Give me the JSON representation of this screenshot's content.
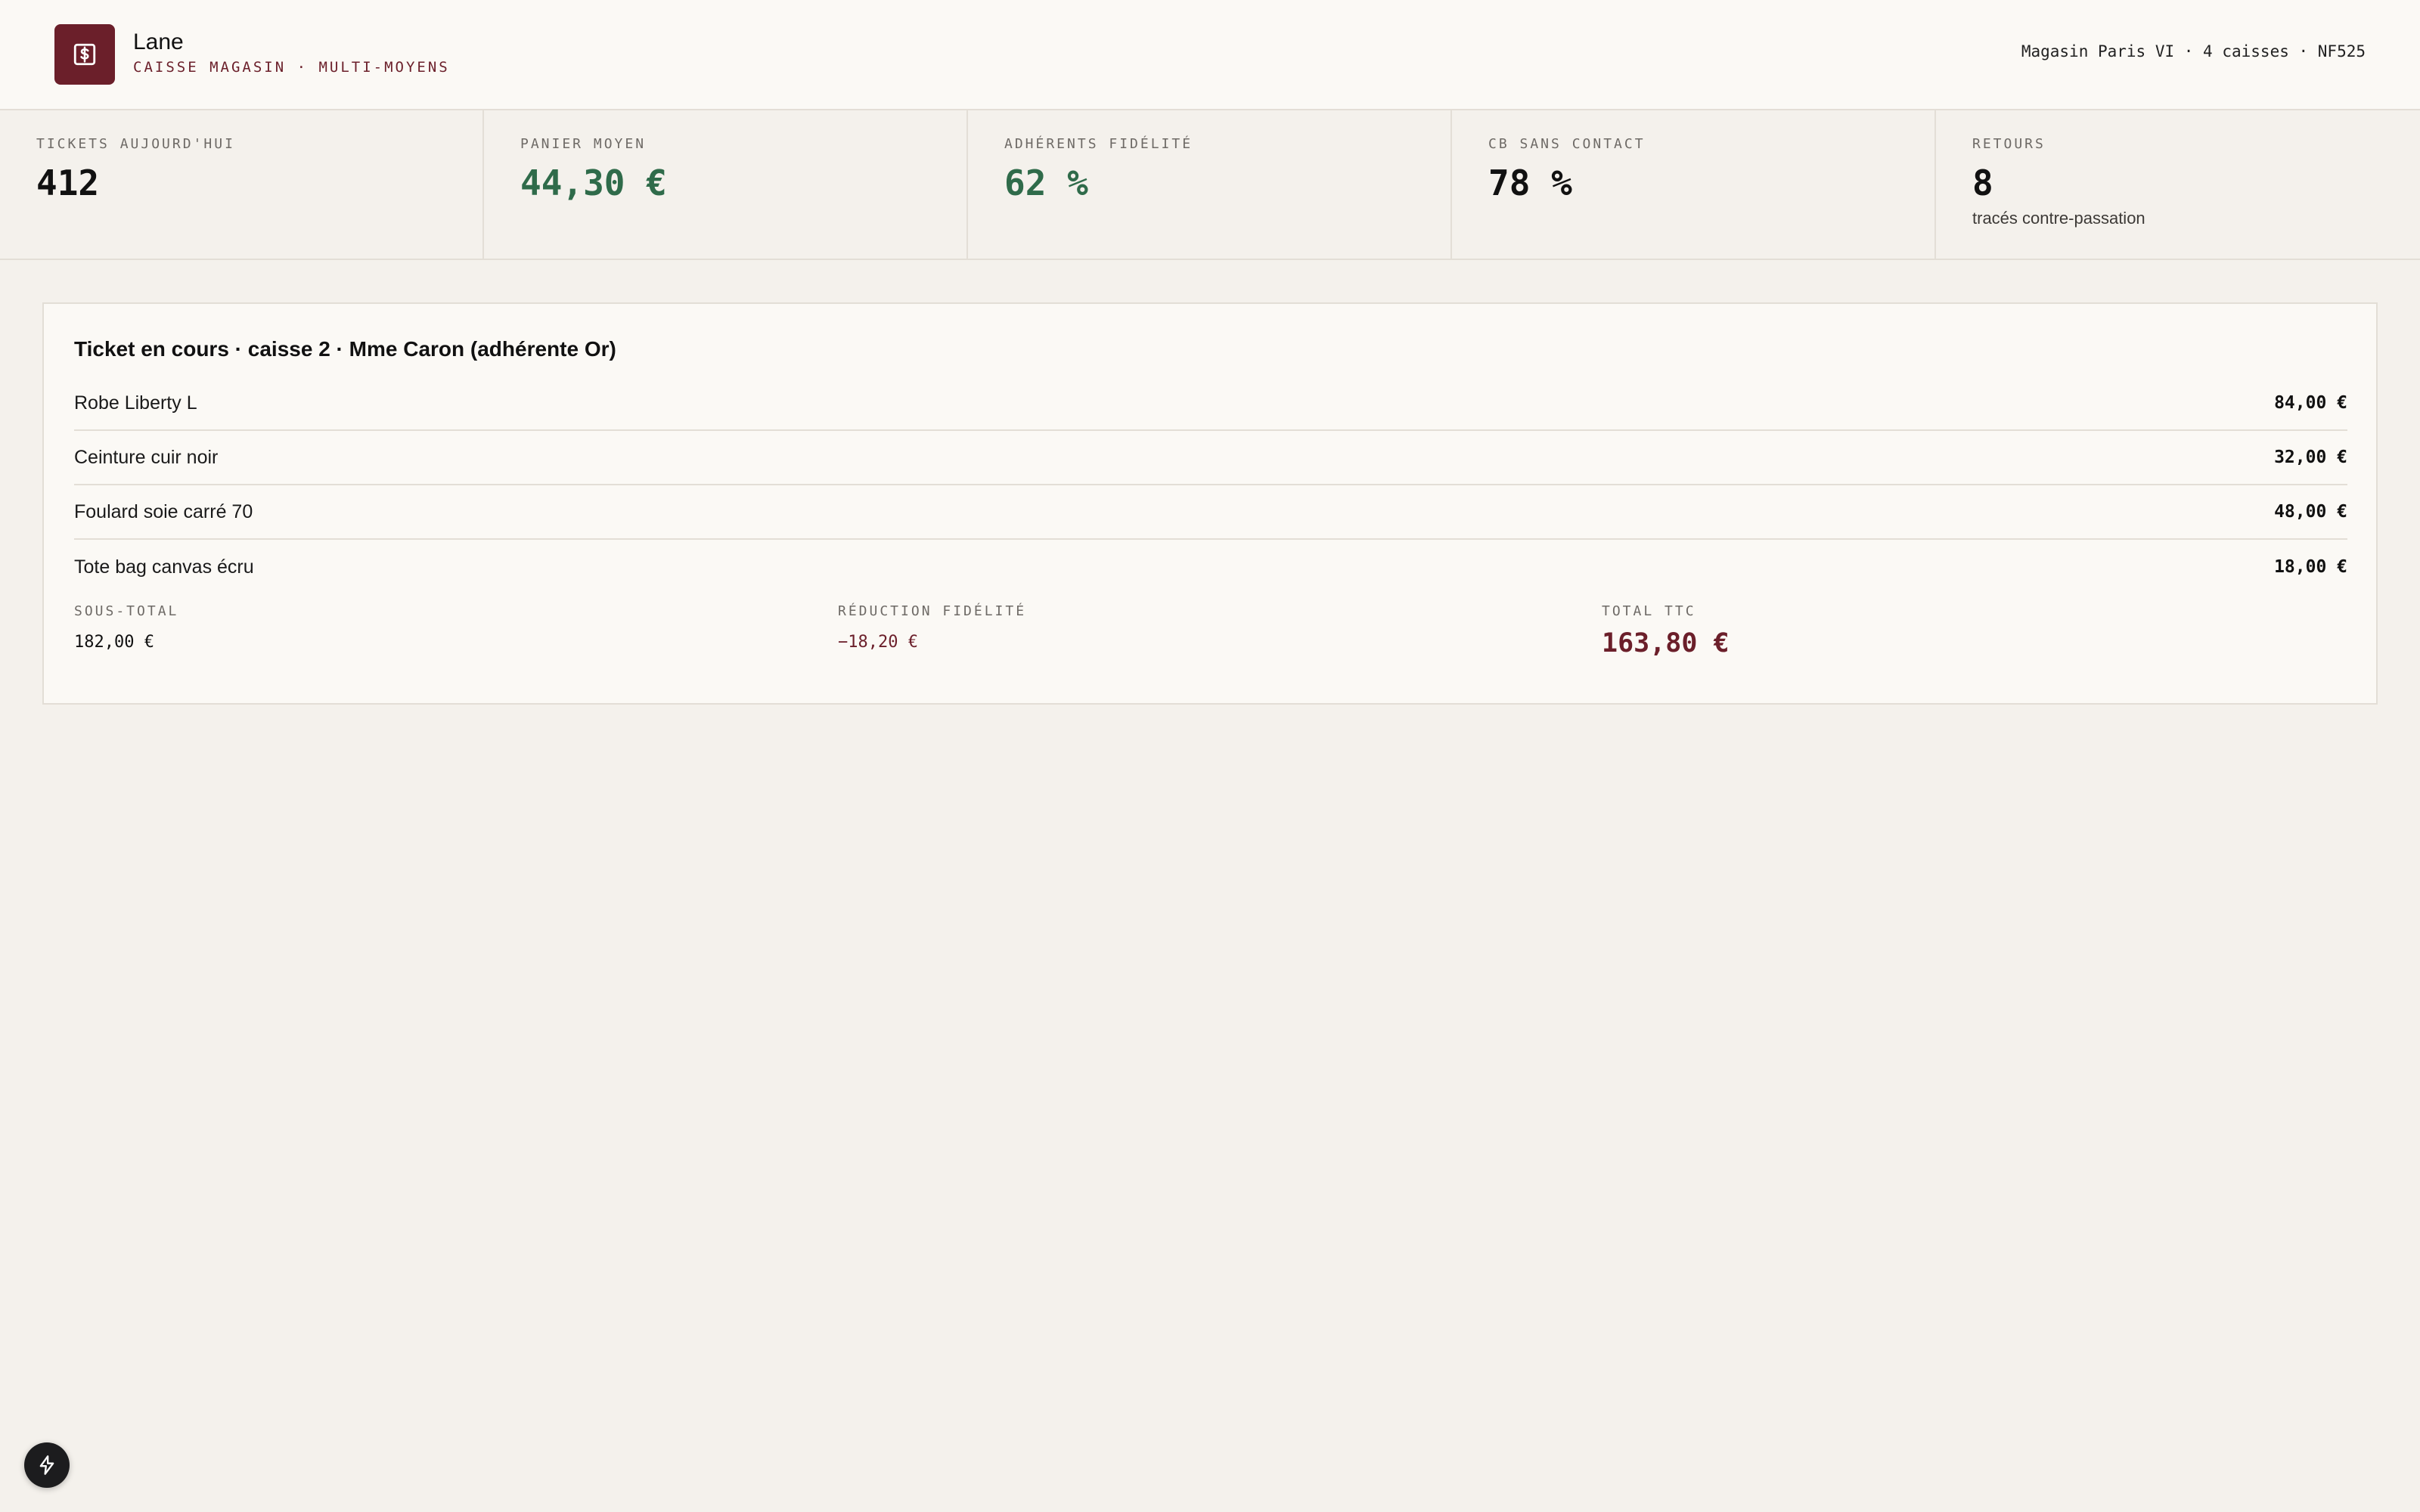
{
  "header": {
    "brand_icon": "dollar-receipt-icon",
    "brand_name": "Lane",
    "brand_subtitle": "CAISSE MAGASIN · MULTI-MOYENS",
    "store_info": "Magasin Paris VI · 4 caisses · NF525"
  },
  "kpis": [
    {
      "label": "TICKETS AUJOURD'HUI",
      "value": "412",
      "note": "",
      "color": "#111111"
    },
    {
      "label": "PANIER MOYEN",
      "value": "44,30 €",
      "note": "",
      "color": "#2f6b4a"
    },
    {
      "label": "ADHÉRENTS FIDÉLITÉ",
      "value": "62 %",
      "note": "",
      "color": "#2f6b4a"
    },
    {
      "label": "CB SANS CONTACT",
      "value": "78 %",
      "note": "",
      "color": "#111111"
    },
    {
      "label": "RETOURS",
      "value": "8",
      "note": "tracés contre-passation",
      "color": "#111111"
    }
  ],
  "ticket": {
    "title": "Ticket en cours · caisse 2 · Mme Caron (adhérente Or)",
    "items": [
      {
        "name": "Robe Liberty L",
        "price": "84,00 €"
      },
      {
        "name": "Ceinture cuir noir",
        "price": "32,00 €"
      },
      {
        "name": "Foulard soie carré 70",
        "price": "48,00 €"
      },
      {
        "name": "Tote bag canvas écru",
        "price": "18,00 €"
      }
    ],
    "subtotal_label": "SOUS-TOTAL",
    "subtotal_value": "182,00 €",
    "discount_label": "RÉDUCTION FIDÉLITÉ",
    "discount_value": "−18,20 €",
    "total_label": "TOTAL TTC",
    "total_value": "163,80 €"
  },
  "fab": {
    "icon": "lightning-icon"
  },
  "colors": {
    "accent": "#6b1f2a",
    "positive": "#2f6b4a",
    "background": "#f4f1ec",
    "surface": "#fbf9f5"
  }
}
